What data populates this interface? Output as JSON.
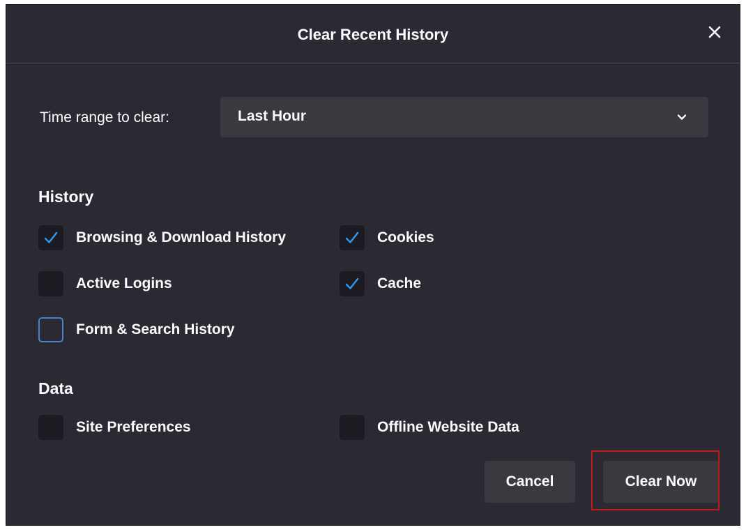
{
  "dialog": {
    "title": "Clear Recent History",
    "close_icon": "close-icon"
  },
  "time_range": {
    "label": "Time range to clear:",
    "selected": "Last Hour",
    "chevron_icon": "chevron-down-icon"
  },
  "history": {
    "heading": "History",
    "items": [
      {
        "label": "Browsing & Download History",
        "checked": true
      },
      {
        "label": "Cookies",
        "checked": true
      },
      {
        "label": "Active Logins",
        "checked": false
      },
      {
        "label": "Cache",
        "checked": true
      },
      {
        "label": "Form & Search History",
        "checked": false
      }
    ]
  },
  "data_section": {
    "heading": "Data",
    "items": [
      {
        "label": "Site Preferences",
        "checked": false
      },
      {
        "label": "Offline Website Data",
        "checked": false
      }
    ]
  },
  "buttons": {
    "cancel": "Cancel",
    "clear_now": "Clear Now"
  },
  "colors": {
    "dialog_bg": "#2b2a33",
    "checkmark": "#2d9bf0",
    "highlight": "#c41a1a"
  }
}
